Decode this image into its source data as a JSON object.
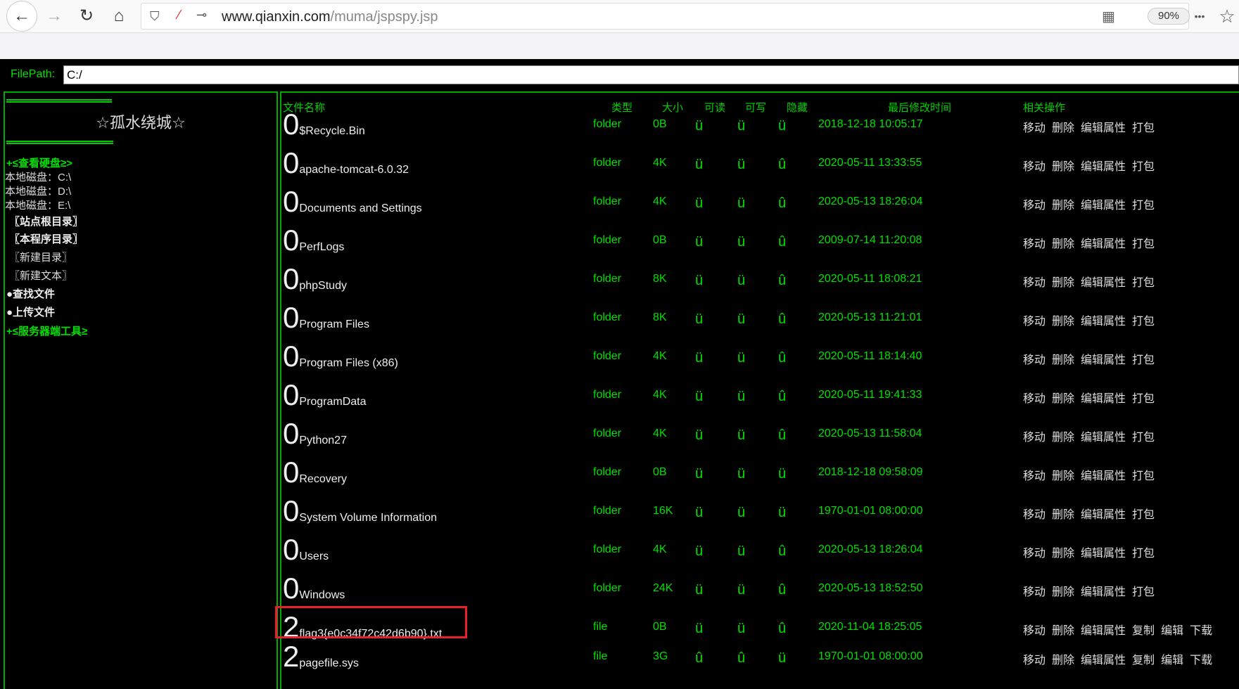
{
  "browser": {
    "url_domain": "www.qianxin.com",
    "url_path": "/muma/jspspy.jsp",
    "zoom": "90%",
    "back_icon": "←",
    "forward_icon": "→",
    "reload_icon": "↻",
    "home_icon": "⌂",
    "menu_icon": "•••",
    "star_icon": "☆"
  },
  "filepath": {
    "label": "FilePath:",
    "value": "C:/"
  },
  "sidebar": {
    "title": "☆孤水绕城☆",
    "view_disks": "+≤查看硬盘≥>",
    "disks": [
      "本地磁盘：C:\\",
      "本地磁盘：D:\\",
      "本地磁盘：E:\\"
    ],
    "site_root": "〖站点根目录〗",
    "program_dir": "〖本程序目录〗",
    "new_dir": "〖新建目录〗",
    "new_text": "〖新建文本〗",
    "find_file": "●查找文件",
    "upload_file": "●上传文件",
    "server_tools": "+≤服务器端工具≥"
  },
  "headers": {
    "name": "文件名称",
    "type": "类型",
    "size": "大小",
    "readable": "可读",
    "writable": "可写",
    "hidden": "隐藏",
    "mtime": "最后修改时间",
    "ops": "相关操作"
  },
  "files": [
    {
      "icon": "0",
      "name": "$Recycle.Bin",
      "type": "folder",
      "size": "0B",
      "r": "ü",
      "w": "ü",
      "h": "ü",
      "mtime": "2018-12-18 10:05:17",
      "ops": [
        "移动",
        "删除",
        "编辑属性",
        "打包"
      ]
    },
    {
      "icon": "0",
      "name": "apache-tomcat-6.0.32",
      "type": "folder",
      "size": "4K",
      "r": "ü",
      "w": "ü",
      "h": "û",
      "mtime": "2020-05-11 13:33:55",
      "ops": [
        "移动",
        "删除",
        "编辑属性",
        "打包"
      ]
    },
    {
      "icon": "0",
      "name": "Documents and Settings",
      "type": "folder",
      "size": "4K",
      "r": "ü",
      "w": "ü",
      "h": "û",
      "mtime": "2020-05-13 18:26:04",
      "ops": [
        "移动",
        "删除",
        "编辑属性",
        "打包"
      ]
    },
    {
      "icon": "0",
      "name": "PerfLogs",
      "type": "folder",
      "size": "0B",
      "r": "ü",
      "w": "ü",
      "h": "û",
      "mtime": "2009-07-14 11:20:08",
      "ops": [
        "移动",
        "删除",
        "编辑属性",
        "打包"
      ]
    },
    {
      "icon": "0",
      "name": "phpStudy",
      "type": "folder",
      "size": "8K",
      "r": "ü",
      "w": "ü",
      "h": "û",
      "mtime": "2020-05-11 18:08:21",
      "ops": [
        "移动",
        "删除",
        "编辑属性",
        "打包"
      ]
    },
    {
      "icon": "0",
      "name": "Program Files",
      "type": "folder",
      "size": "8K",
      "r": "ü",
      "w": "ü",
      "h": "û",
      "mtime": "2020-05-13 11:21:01",
      "ops": [
        "移动",
        "删除",
        "编辑属性",
        "打包"
      ]
    },
    {
      "icon": "0",
      "name": "Program Files (x86)",
      "type": "folder",
      "size": "4K",
      "r": "ü",
      "w": "ü",
      "h": "û",
      "mtime": "2020-05-11 18:14:40",
      "ops": [
        "移动",
        "删除",
        "编辑属性",
        "打包"
      ]
    },
    {
      "icon": "0",
      "name": "ProgramData",
      "type": "folder",
      "size": "4K",
      "r": "ü",
      "w": "ü",
      "h": "û",
      "mtime": "2020-05-11 19:41:33",
      "ops": [
        "移动",
        "删除",
        "编辑属性",
        "打包"
      ]
    },
    {
      "icon": "0",
      "name": "Python27",
      "type": "folder",
      "size": "4K",
      "r": "ü",
      "w": "ü",
      "h": "û",
      "mtime": "2020-05-13 11:58:04",
      "ops": [
        "移动",
        "删除",
        "编辑属性",
        "打包"
      ]
    },
    {
      "icon": "0",
      "name": "Recovery",
      "type": "folder",
      "size": "0B",
      "r": "ü",
      "w": "ü",
      "h": "ü",
      "mtime": "2018-12-18 09:58:09",
      "ops": [
        "移动",
        "删除",
        "编辑属性",
        "打包"
      ]
    },
    {
      "icon": "0",
      "name": "System Volume Information",
      "type": "folder",
      "size": "16K",
      "r": "ü",
      "w": "ü",
      "h": "ü",
      "mtime": "1970-01-01 08:00:00",
      "ops": [
        "移动",
        "删除",
        "编辑属性",
        "打包"
      ]
    },
    {
      "icon": "0",
      "name": "Users",
      "type": "folder",
      "size": "4K",
      "r": "ü",
      "w": "ü",
      "h": "û",
      "mtime": "2020-05-13 18:26:04",
      "ops": [
        "移动",
        "删除",
        "编辑属性",
        "打包"
      ]
    },
    {
      "icon": "0",
      "name": "Windows",
      "type": "folder",
      "size": "24K",
      "r": "ü",
      "w": "ü",
      "h": "û",
      "mtime": "2020-05-13 18:52:50",
      "ops": [
        "移动",
        "删除",
        "编辑属性",
        "打包"
      ]
    },
    {
      "icon": "2",
      "name": "flag3{e0c34f72c42d6b90}.txt",
      "type": "file",
      "size": "0B",
      "r": "ü",
      "w": "ü",
      "h": "û",
      "mtime": "2020-11-04 18:25:05",
      "ops": [
        "移动",
        "删除",
        "编辑属性",
        "复制",
        "编辑",
        "下载"
      ]
    },
    {
      "icon": "2",
      "name": "pagefile.sys",
      "type": "file",
      "size": "3G",
      "r": "û",
      "w": "û",
      "h": "ü",
      "mtime": "1970-01-01 08:00:00",
      "ops": [
        "移动",
        "删除",
        "编辑属性",
        "复制",
        "编辑",
        "下载"
      ]
    }
  ]
}
